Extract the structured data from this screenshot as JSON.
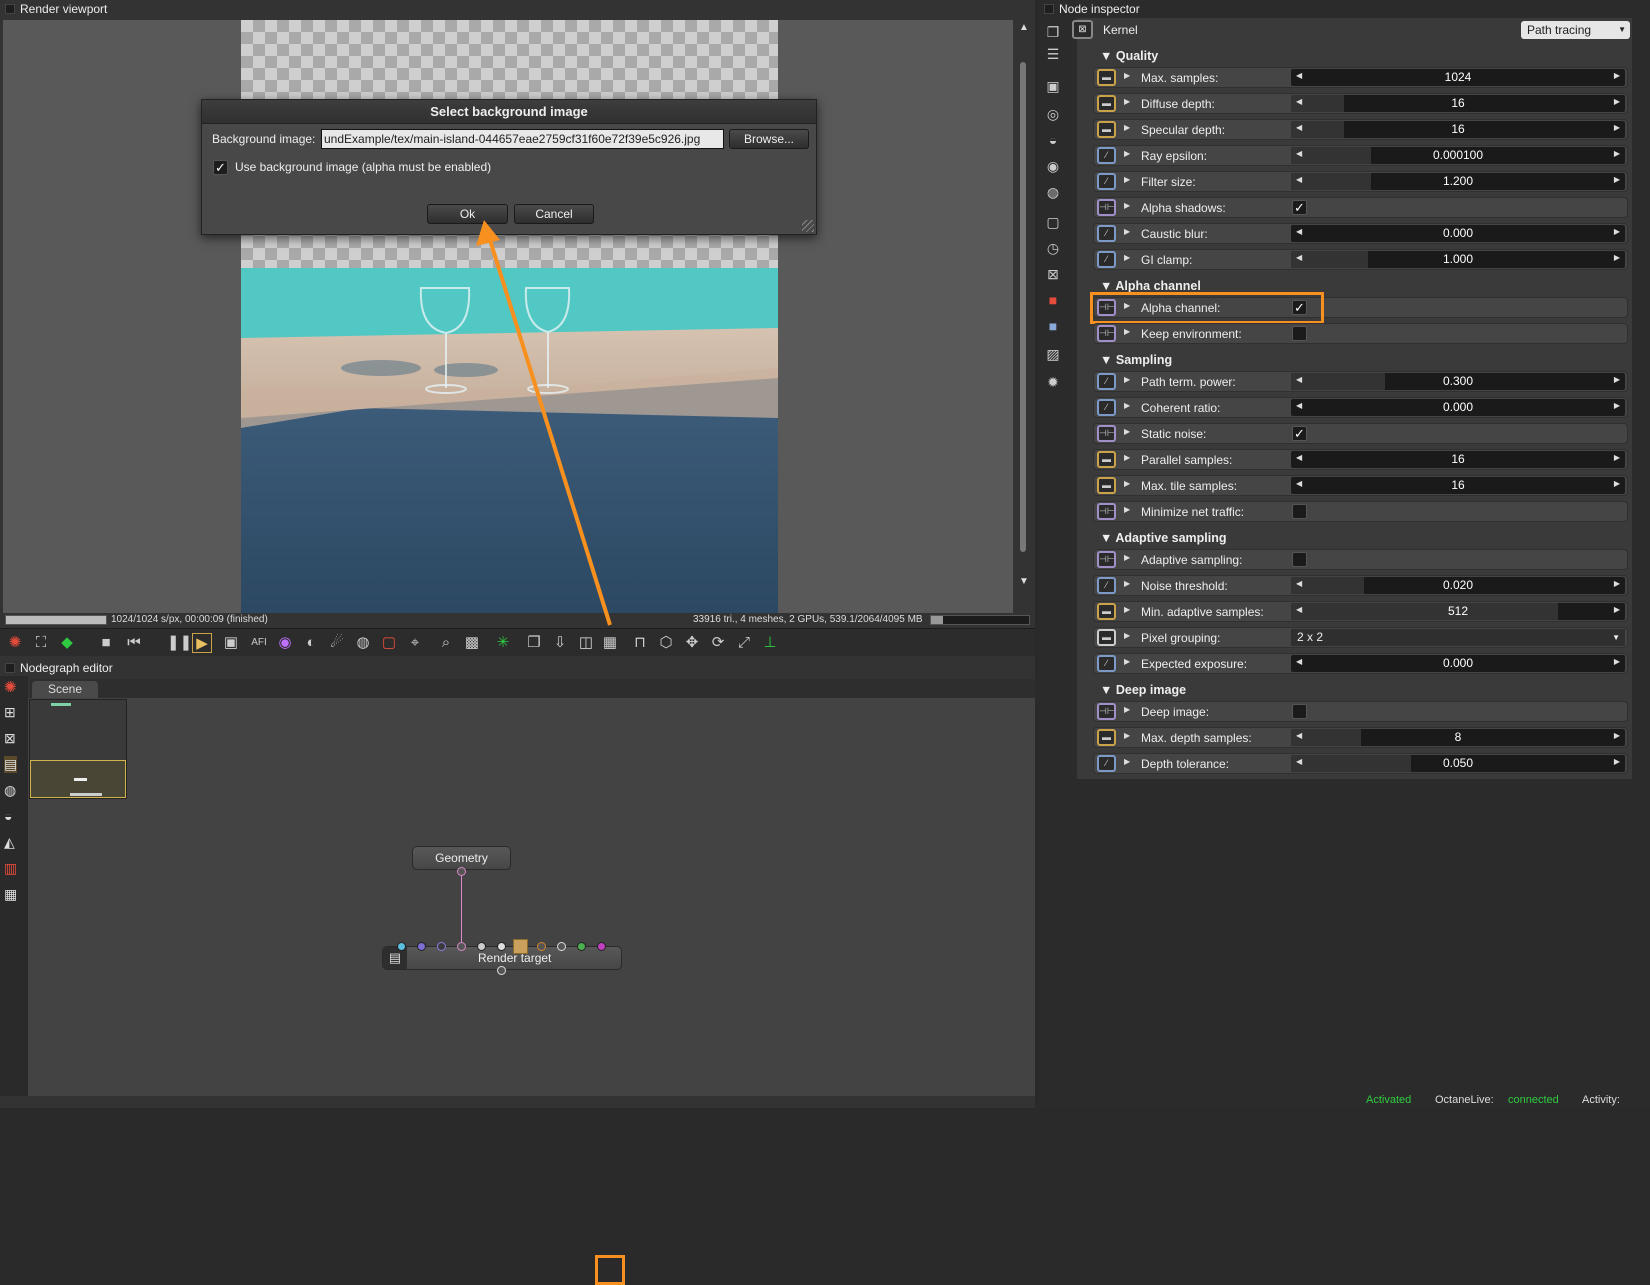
{
  "viewport": {
    "title": "Render viewport",
    "status_left": "1024/1024 s/px, 00:00:09 (finished)",
    "status_right": "33916 tri., 4 meshes, 2 GPUs, 539.1/2064/4095 MB",
    "progress": 1.0
  },
  "dialog": {
    "title": "Select background image",
    "field_label": "Background image:",
    "field_value": "undExample/tex/main-island-044657eae2759cf31f60e72f39e5c926.jpg",
    "browse_label": "Browse...",
    "checkbox_label": "Use background image (alpha must be enabled)",
    "checkbox_checked": true,
    "ok_label": "Ok",
    "cancel_label": "Cancel"
  },
  "toolbar": {
    "icons": [
      "octane-logo-icon",
      "clay-mode-icon",
      "cube-color-icon",
      "stop-icon",
      "rewind-icon",
      "pause-icon",
      "play-icon",
      "monitor-icon",
      "afi-icon",
      "color-wheel-icon",
      "sphere-icon",
      "light-icon",
      "material-icon",
      "box-icon",
      "picker-icon",
      "zoom-icon",
      "region-icon",
      "spinner-icon",
      "copy-icon",
      "export-icon",
      "layers-icon",
      "background-image-icon",
      "lock-icon",
      "cube-icon",
      "move-icon",
      "refresh-icon",
      "fullscreen-icon",
      "axis-icon"
    ]
  },
  "nodegraph": {
    "title": "Nodegraph editor",
    "tab": "Scene",
    "node_geometry": "Geometry",
    "node_render_target": "Render target"
  },
  "inspector": {
    "title": "Node inspector",
    "kernel_label": "Kernel",
    "kernel_value": "Path tracing",
    "sections": {
      "quality": "Quality",
      "alpha": "Alpha channel",
      "sampling": "Sampling",
      "adaptive": "Adaptive sampling",
      "deep": "Deep image"
    },
    "rows": {
      "max_samples": {
        "label": "Max. samples:",
        "value": "1024",
        "fill": 0.0
      },
      "diffuse_depth": {
        "label": "Diffuse depth:",
        "value": "16",
        "fill": 0.16
      },
      "specular_depth": {
        "label": "Specular depth:",
        "value": "16",
        "fill": 0.16
      },
      "ray_epsilon": {
        "label": "Ray epsilon:",
        "value": "0.000100",
        "fill": 0.24
      },
      "filter_size": {
        "label": "Filter size:",
        "value": "1.200",
        "fill": 0.24
      },
      "alpha_shadows": {
        "label": "Alpha shadows:",
        "checked": "✓"
      },
      "caustic_blur": {
        "label": "Caustic blur:",
        "value": "0.000",
        "fill": 0.0
      },
      "gi_clamp": {
        "label": "GI clamp:",
        "value": "1.000",
        "fill": 0.23
      },
      "alpha_channel": {
        "label": "Alpha channel:",
        "checked": "✓"
      },
      "keep_env": {
        "label": "Keep environment:",
        "checked": ""
      },
      "path_term": {
        "label": "Path term. power:",
        "value": "0.300",
        "fill": 0.28
      },
      "coherent": {
        "label": "Coherent ratio:",
        "value": "0.000",
        "fill": 0.0
      },
      "static_noise": {
        "label": "Static noise:",
        "checked": "✓"
      },
      "parallel": {
        "label": "Parallel samples:",
        "value": "16",
        "fill": 0.0
      },
      "max_tile": {
        "label": "Max. tile samples:",
        "value": "16",
        "fill": 0.0
      },
      "min_net": {
        "label": "Minimize net traffic:",
        "checked": ""
      },
      "adaptive": {
        "label": "Adaptive sampling:",
        "checked": ""
      },
      "noise_thr": {
        "label": "Noise threshold:",
        "value": "0.020",
        "fill": 0.22
      },
      "min_adaptive": {
        "label": "Min. adaptive samples:",
        "value": "512",
        "fill": 0.8
      },
      "pixel_grouping": {
        "label": "Pixel grouping:",
        "value": "2 x 2"
      },
      "expected_exposure": {
        "label": "Expected exposure:",
        "value": "0.000",
        "fill": 0.0
      },
      "deep_image": {
        "label": "Deep image:",
        "checked": ""
      },
      "max_depth": {
        "label": "Max. depth samples:",
        "value": "8",
        "fill": 0.21
      },
      "depth_tol": {
        "label": "Depth tolerance:",
        "value": "0.050",
        "fill": 0.36
      }
    }
  },
  "status_bottom": {
    "activated": "Activated",
    "octane_live": "OctaneLive:",
    "connected": "connected",
    "activity": "Activity:"
  },
  "colors": {
    "highlight": "#f7901e",
    "connected": "#2ecc40"
  }
}
